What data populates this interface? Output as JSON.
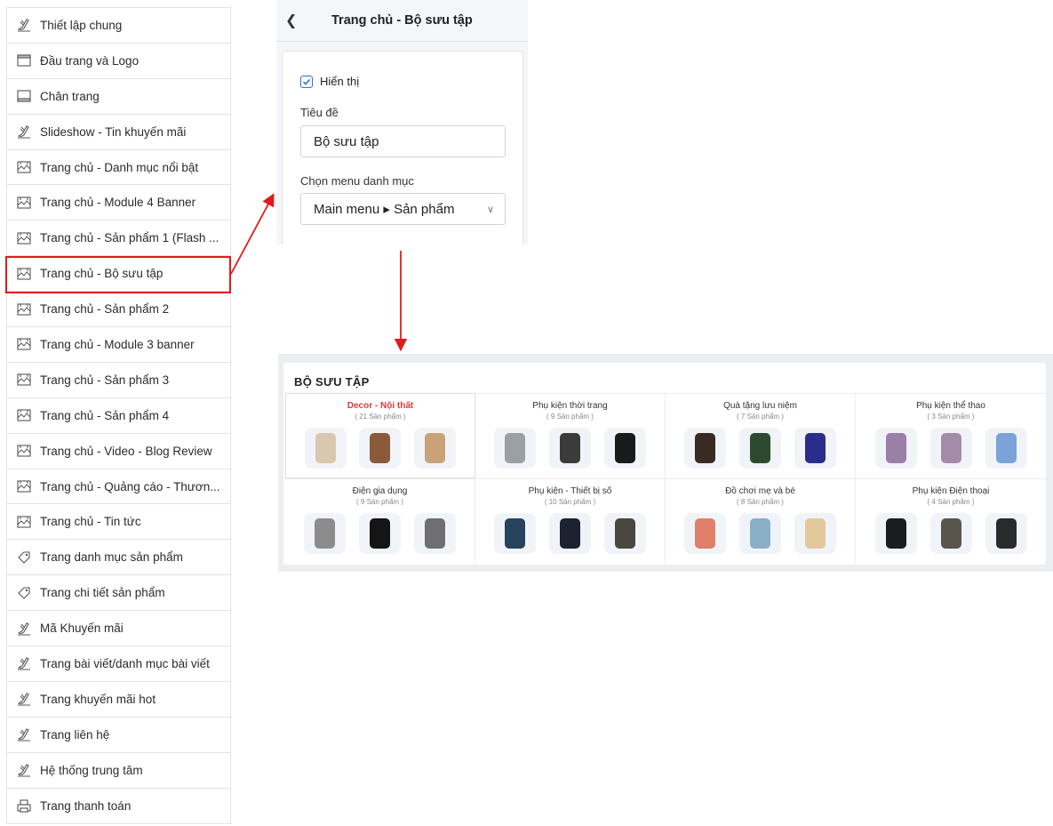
{
  "sidebar": {
    "items": [
      {
        "label": "Thiết lập chung",
        "icon": "brush-icon"
      },
      {
        "label": "Đầu trang và Logo",
        "icon": "header-icon"
      },
      {
        "label": "Chân trang",
        "icon": "footer-icon"
      },
      {
        "label": "Slideshow - Tin khuyến mãi",
        "icon": "brush-icon"
      },
      {
        "label": "Trang chủ - Danh mục nổi bật",
        "icon": "home-layout-icon"
      },
      {
        "label": "Trang chủ - Module 4 Banner",
        "icon": "home-layout-icon"
      },
      {
        "label": "Trang chủ - Sản phẩm 1 (Flash ...",
        "icon": "home-layout-icon"
      },
      {
        "label": "Trang chủ - Bộ sưu tập",
        "icon": "home-layout-icon",
        "selected": true
      },
      {
        "label": "Trang chủ - Sản phẩm 2",
        "icon": "home-layout-icon"
      },
      {
        "label": "Trang chủ - Module 3 banner",
        "icon": "home-layout-icon"
      },
      {
        "label": "Trang chủ - Sản phẩm 3",
        "icon": "home-layout-icon"
      },
      {
        "label": "Trang chủ - Sản phẩm 4",
        "icon": "home-layout-icon"
      },
      {
        "label": "Trang chủ - Video - Blog Review",
        "icon": "home-layout-icon"
      },
      {
        "label": "Trang chủ - Quảng cáo - Thươn...",
        "icon": "home-layout-icon"
      },
      {
        "label": "Trang chủ - Tin tức",
        "icon": "home-layout-icon"
      },
      {
        "label": "Trang danh mục sản phẩm",
        "icon": "tag-icon"
      },
      {
        "label": "Trang chi tiết sản phẩm",
        "icon": "tag-icon"
      },
      {
        "label": "Mã Khuyến mãi",
        "icon": "brush-icon"
      },
      {
        "label": "Trang bài viết/danh mục bài viết",
        "icon": "brush-icon"
      },
      {
        "label": "Trang khuyến mãi hot",
        "icon": "brush-icon"
      },
      {
        "label": "Trang liên hệ",
        "icon": "brush-icon"
      },
      {
        "label": "Hệ thống trung tâm",
        "icon": "brush-icon"
      },
      {
        "label": "Trang thanh toán",
        "icon": "printer-icon"
      }
    ]
  },
  "panel": {
    "title": "Trang chủ - Bộ sưu tập",
    "show_label": "Hiển thị",
    "show_checked": true,
    "title_field_label": "Tiêu đề",
    "title_field_value": "Bộ sưu tập",
    "menu_field_label": "Chọn menu danh mục",
    "menu_field_value": "Main menu ▸ Sản phẩm"
  },
  "collection": {
    "heading": "BỘ SƯU TẬP",
    "cells": [
      {
        "name": "Decor - Nội thất",
        "count": "( 21 Sản phẩm )",
        "active": true,
        "thumbs": [
          "#d9c7b0",
          "#8a5a3a",
          "#c9a27a"
        ]
      },
      {
        "name": "Phụ kiện thời trang",
        "count": "( 9 Sản phẩm )",
        "thumbs": [
          "#9aa0a6",
          "#3b3b3b",
          "#1a1a1a"
        ]
      },
      {
        "name": "Quà tặng lưu niệm",
        "count": "( 7 Sản phẩm )",
        "thumbs": [
          "#3a2a24",
          "#2e4a2e",
          "#2a2e8a"
        ]
      },
      {
        "name": "Phụ kiện thể thao",
        "count": "( 3 Sản phẩm )",
        "thumbs": [
          "#9b7fa8",
          "#a48ca8",
          "#7aa4d8"
        ]
      },
      {
        "name": "Điện gia dụng",
        "count": "( 9 Sản phẩm )",
        "thumbs": [
          "#8c8c8c",
          "#151515",
          "#6f6f6f"
        ]
      },
      {
        "name": "Phụ kiện - Thiết bị số",
        "count": "( 10 Sản phẩm )",
        "thumbs": [
          "#27435e",
          "#1c2230",
          "#4a4640"
        ]
      },
      {
        "name": "Đồ chơi mẹ và bé",
        "count": "( 8 Sản phẩm )",
        "thumbs": [
          "#e0806a",
          "#8ab0c8",
          "#e3c89c"
        ]
      },
      {
        "name": "Phụ kiện Điện thoại",
        "count": "( 4 Sản phẩm )",
        "thumbs": [
          "#1c1c1c",
          "#5a554c",
          "#2a2a2a"
        ]
      }
    ]
  },
  "colors": {
    "highlight": "#e01b1b",
    "active_text": "#e53935",
    "checkbox": "#2a6fdb"
  }
}
